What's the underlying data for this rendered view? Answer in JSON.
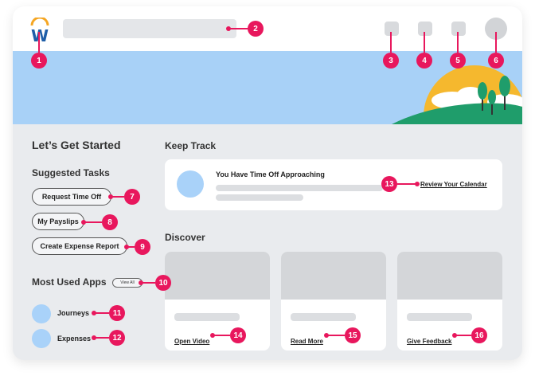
{
  "header": {
    "logo_letter": "W"
  },
  "left": {
    "title": "Let’s Get Started",
    "suggested_title": "Suggested Tasks",
    "tasks": [
      "Request Time Off",
      "My Payslips",
      "Create Expense Report"
    ],
    "apps_title": "Most Used Apps",
    "view_all": "View All",
    "apps": [
      "Journeys",
      "Expenses"
    ]
  },
  "track": {
    "title": "Keep Track",
    "message": "You Have Time Off Approaching",
    "link": "Review Your Calendar"
  },
  "discover": {
    "title": "Discover",
    "cards": [
      "Open Video",
      "Read More",
      "Give Feedback"
    ]
  },
  "markers": [
    "1",
    "2",
    "3",
    "4",
    "5",
    "6",
    "7",
    "8",
    "9",
    "10",
    "11",
    "12",
    "13",
    "14",
    "15",
    "16"
  ],
  "colors": {
    "marker": "#e8175d",
    "sky": "#a8d1f7",
    "sun": "#f5b82e",
    "hill": "#1f9d6b"
  }
}
